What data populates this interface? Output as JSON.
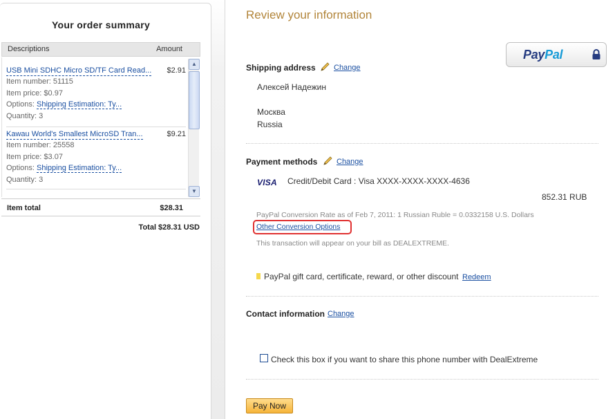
{
  "order_summary": {
    "title": "Your order summary",
    "columns": {
      "descriptions": "Descriptions",
      "amount": "Amount"
    },
    "items": [
      {
        "name": "USB Mini SDHC Micro SD/TF Card Read...",
        "price": "$2.91",
        "item_number": "Item number: 51115",
        "item_price": "Item price: $0.97",
        "options_label": "Options:",
        "options_value": "Shipping Estimation: Ty...",
        "quantity": "Quantity: 3"
      },
      {
        "name": "Kawau World's Smallest MicroSD Tran...",
        "price": "$9.21",
        "item_number": "Item number: 25558",
        "item_price": "Item price: $3.07",
        "options_label": "Options:",
        "options_value": "Shipping Estimation: Ty...",
        "quantity": "Quantity: 3"
      }
    ],
    "item_total_label": "Item total",
    "item_total_value": "$28.31",
    "grand_total": "Total $28.31 USD"
  },
  "review": {
    "title": "Review your information",
    "paypal_logo": {
      "pay": "Pay",
      "pal": "Pal"
    },
    "shipping": {
      "label": "Shipping address",
      "change": "Change",
      "name": "Алексей Надежин",
      "city": "Москва",
      "country": "Russia"
    },
    "payment": {
      "label": "Payment methods",
      "change": "Change",
      "card_logo": "VISA",
      "card": "Credit/Debit Card : Visa XXXX-XXXX-XXXX-4636",
      "amount": "852.31 RUB",
      "conversion_rate": "PayPal Conversion Rate as of Feb 7, 2011: 1 Russian Ruble = 0.0332158 U.S. Dollars",
      "conversion_options": "Other Conversion Options",
      "bill_note": "This transaction will appear on your bill as DEALEXTREME.",
      "gift": "PayPal gift card, certificate, reward, or other discount",
      "redeem": "Redeem"
    },
    "contact": {
      "label": "Contact information",
      "change": "Change",
      "share_checkbox_label": "Check this box if you want to share this phone number with DealExtreme",
      "share_checked": false
    },
    "pay_button": "Pay Now"
  },
  "colors": {
    "title_gold": "#b2853a",
    "link_blue": "#1a4fa1",
    "highlight_red": "#e03030",
    "button_orange": "#f6b43a"
  }
}
